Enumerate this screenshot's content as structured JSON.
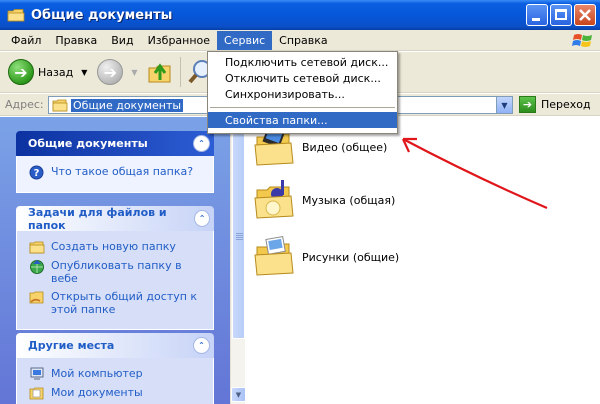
{
  "window": {
    "title": "Общие документы"
  },
  "menu": {
    "items": [
      "Файл",
      "Правка",
      "Вид",
      "Избранное",
      "Сервис",
      "Справка"
    ],
    "active_index": 4
  },
  "toolbar": {
    "back_label": "Назад"
  },
  "address": {
    "label": "Адрес:",
    "value": "Общие документы",
    "go_label": "Переход"
  },
  "service_menu": {
    "items": [
      "Подключить сетевой диск...",
      "Отключить сетевой диск...",
      "Синхронизировать...",
      "Свойства папки..."
    ],
    "highlighted_index": 3
  },
  "task_pane": {
    "panels": [
      {
        "title": "Общие документы",
        "links": [
          "Что такое общая папка?"
        ]
      },
      {
        "title": "Задачи для файлов и папок",
        "links": [
          "Создать новую папку",
          "Опубликовать папку в вебе",
          "Открыть общий доступ к этой папке"
        ]
      },
      {
        "title": "Другие места",
        "links": [
          "Мой компьютер",
          "Мои документы"
        ]
      }
    ]
  },
  "folders": [
    {
      "name": "Видео (общее)",
      "icon": "video-folder-icon"
    },
    {
      "name": "Музыка (общая)",
      "icon": "music-folder-icon"
    },
    {
      "name": "Рисунки (общие)",
      "icon": "pictures-folder-icon"
    }
  ],
  "colors": {
    "titlebar": "#0757db",
    "menu_highlight": "#316ac5",
    "pane_bg": "#6f8fe0",
    "annotation_arrow": "#e0161b"
  }
}
